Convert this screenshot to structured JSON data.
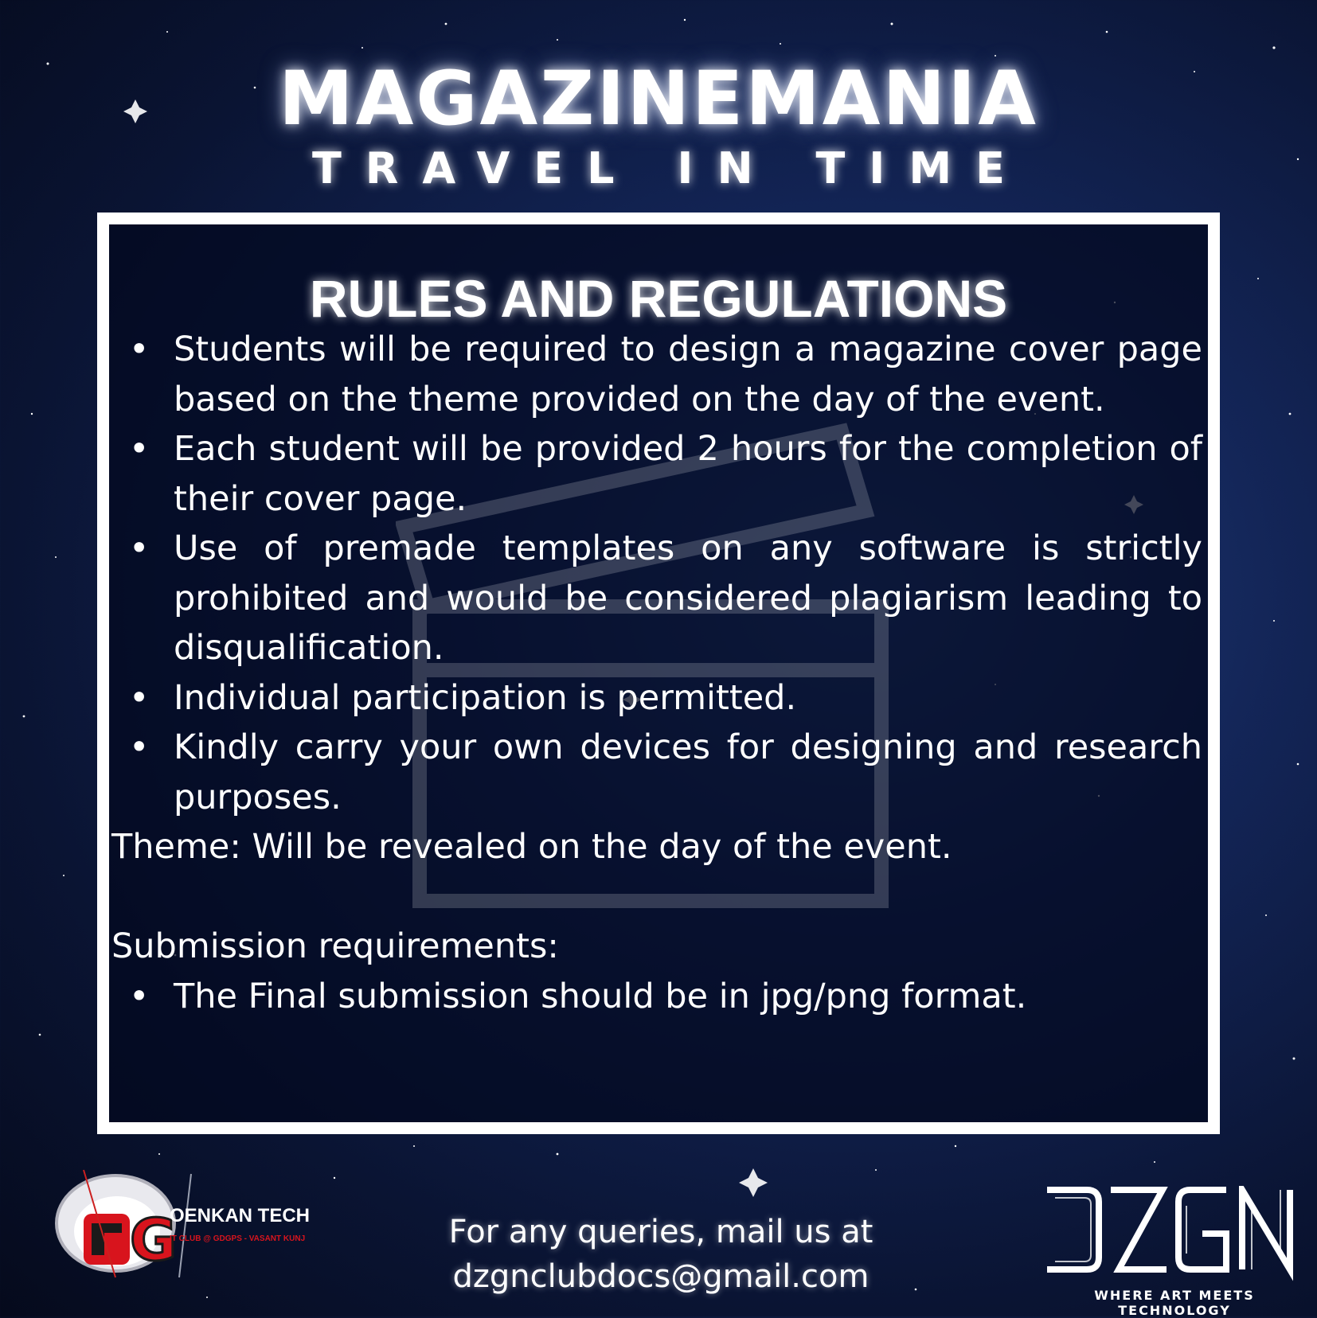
{
  "header": {
    "title": "MAGAZINEMANIA",
    "subtitle": "TRAVEL IN TIME"
  },
  "rules": {
    "heading": "RULES AND REGULATIONS",
    "items": [
      "Students will be required to design a magazine cover page based on the theme provided on the day of the event.",
      "Each student will be provided 2 hours for the completion of their cover page.",
      "Use of premade templates on any software is strictly prohibited and would be considered plagiarism leading to disqualification.",
      "Individual participation is permitted.",
      "Kindly carry your own devices for designing and research purposes."
    ],
    "theme_line": "Theme: Will be revealed on the day of the event.",
    "submission_heading": "Submission requirements:",
    "submission_items": [
      "The Final submission should be in jpg/png format."
    ]
  },
  "footer": {
    "line1": "For any queries, mail us at",
    "email": "dzgnclubdocs@gmail.com"
  },
  "logos": {
    "left_name": "OENKAN TECH GUILD",
    "left_sub": "IT CLUB @ GDGPS - VASANT KUNJ",
    "right_name": "DZGN",
    "right_tagline": "WHERE ART MEETS TECHNOLOGY"
  },
  "colors": {
    "background": "#0a1433",
    "text": "#ffffff",
    "logo_red": "#d8141d"
  }
}
